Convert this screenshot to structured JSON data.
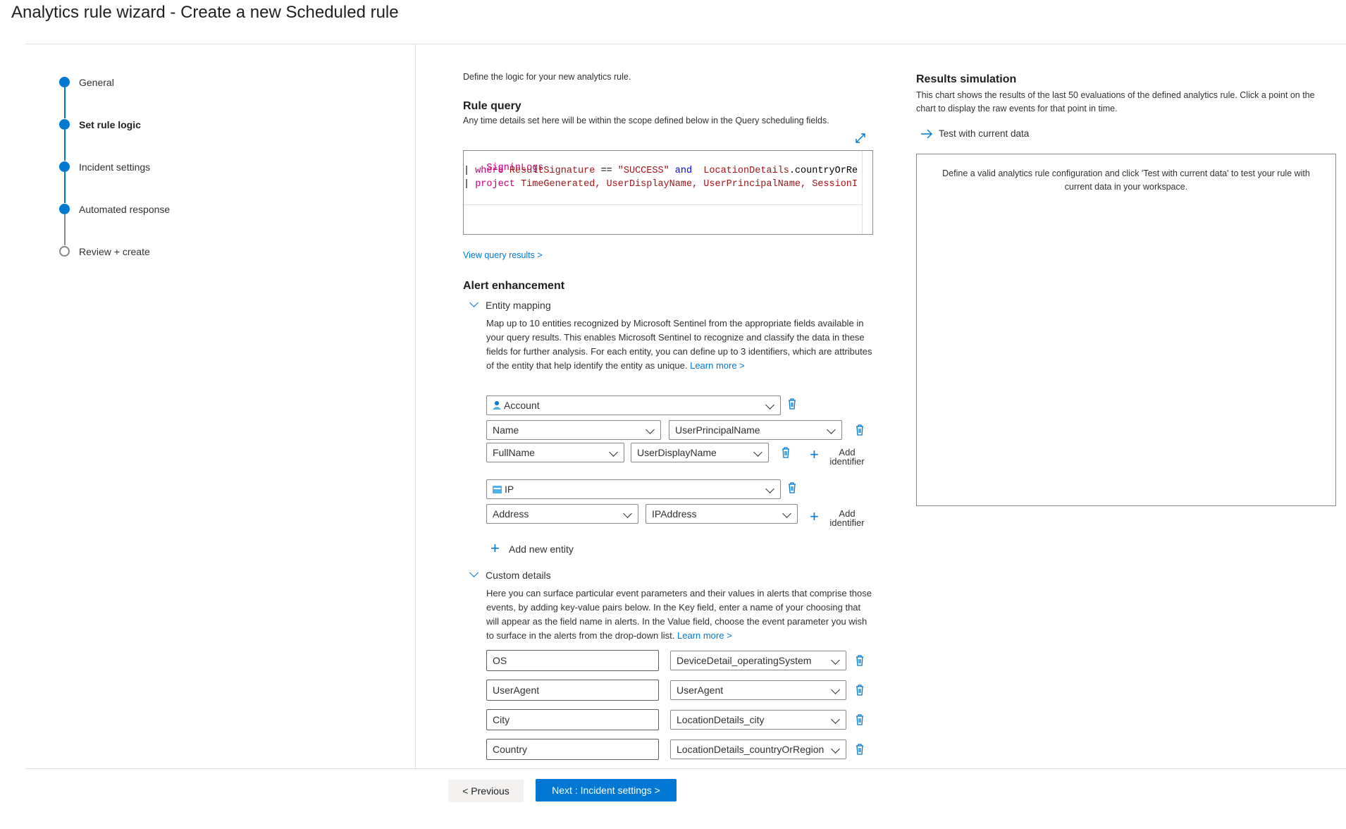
{
  "page": {
    "title": "Analytics rule wizard - Create a new Scheduled rule"
  },
  "steps": [
    {
      "label": "General",
      "state": "complete"
    },
    {
      "label": "Set rule logic",
      "state": "current"
    },
    {
      "label": "Incident settings",
      "state": "complete"
    },
    {
      "label": "Automated response",
      "state": "complete"
    },
    {
      "label": "Review + create",
      "state": "pending"
    }
  ],
  "logic": {
    "intro": "Define the logic for your new analytics rule.",
    "rule_query_title": "Rule query",
    "rule_query_desc": "Any time details set here will be within the scope defined below in the Query scheduling fields.",
    "query": {
      "line1": "SigninLogs",
      "line2_pipe": "| ",
      "line2_where": "where",
      "line2_col": "ResultSignature",
      "line2_op": " == ",
      "line2_str": "\"SUCCESS\"",
      "line2_and": " and ",
      "line2_col2": " LocationDetails",
      "line2_rest": ".countryOrRe",
      "line3_pipe": "| ",
      "line3_project": "project",
      "line3_cols": " TimeGenerated, UserDisplayName, UserPrincipalName, SessionI"
    },
    "view_results_link": "View query results >"
  },
  "alert_enhancement": {
    "title": "Alert enhancement",
    "entity_mapping": {
      "title": "Entity mapping",
      "description": "Map up to 10 entities recognized by Microsoft Sentinel from the appropriate fields available in your query results. This enables Microsoft Sentinel to recognize and classify the data in these fields for further analysis. For each entity, you can define up to 3 identifiers, which are attributes of the entity that help identify the entity as unique.",
      "learn_more": "Learn more >",
      "entities": [
        {
          "type": "Account",
          "identifiers": [
            {
              "identifier": "Name",
              "value": "UserPrincipalName"
            },
            {
              "identifier": "FullName",
              "value": "UserDisplayName"
            }
          ]
        },
        {
          "type": "IP",
          "identifiers": [
            {
              "identifier": "Address",
              "value": "IPAddress"
            }
          ]
        }
      ],
      "add_identifier_l1": "Add",
      "add_identifier_l2": "identifier",
      "add_entity": "Add new entity"
    },
    "custom_details": {
      "title": "Custom details",
      "description": "Here you can surface particular event parameters and their values in alerts that comprise those events, by adding key-value pairs below. In the Key field, enter a name of your choosing that will appear as the field name in alerts. In the Value field, choose the event parameter you wish to surface in the alerts from the drop-down list.",
      "learn_more": "Learn more >",
      "rows": [
        {
          "key": "OS",
          "value": "DeviceDetail_operatingSystem"
        },
        {
          "key": "UserAgent",
          "value": "UserAgent"
        },
        {
          "key": "City",
          "value": "LocationDetails_city"
        },
        {
          "key": "Country",
          "value": "LocationDetails_countryOrRegion"
        }
      ]
    }
  },
  "results": {
    "title": "Results simulation",
    "description": "This chart shows the results of the last 50 evaluations of the defined analytics rule. Click a point on the chart to display the raw events for that point in time.",
    "test_button": "Test with current data",
    "placeholder": "Define a valid analytics rule configuration and click 'Test with current data' to test your rule with current data in your workspace."
  },
  "footer": {
    "previous": "< Previous",
    "next": "Next : Incident settings >"
  },
  "colors": {
    "accent": "#0078d4",
    "trash": "#0078d4"
  }
}
